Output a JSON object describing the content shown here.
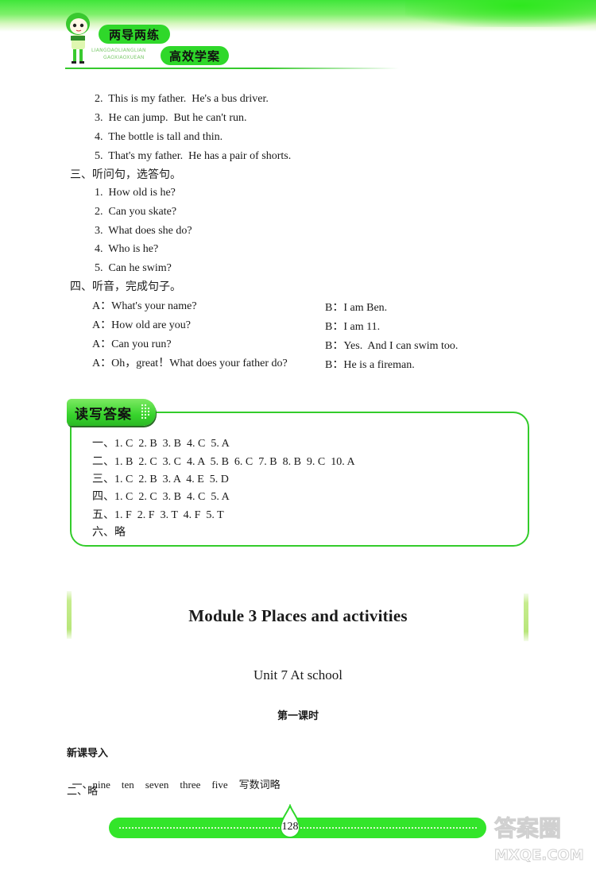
{
  "header": {
    "brand_line1": "两导两练",
    "brand_line2": "高效学案",
    "pinyin_line1": "LIANGDAOLIANGLIAN",
    "pinyin_line2": "GAOXIAOXUEAN",
    "accent_color": "#33d82a"
  },
  "listening_items_cont": [
    "2.  This is my father.  He's a bus driver.",
    "3.  He can jump.  But he can't run.",
    "4.  The bottle is tall and thin.",
    "5.  That's my father.  He has a pair of shorts."
  ],
  "section3": {
    "heading": "三、听问句，选答句。",
    "items": [
      "1.  How old is he?",
      "2.  Can you skate?",
      "3.  What does she do?",
      "4.  Who is he?",
      "5.  Can he swim?"
    ]
  },
  "section4": {
    "heading": "四、听音，完成句子。",
    "dialogue": [
      {
        "a": "A：What's your name?",
        "b": "B：I am Ben."
      },
      {
        "a": "A：How old are you?",
        "b": "B：I am 11."
      },
      {
        "a": "A：Can you run?",
        "b": "B：Yes.  And I can swim too."
      },
      {
        "a": "A：Oh，great！What does your father do?",
        "b": "B：He is a fireman."
      }
    ]
  },
  "answers": {
    "tab_label": "读写答案",
    "lines": [
      "一、1. C  2. B  3. B  4. C  5. A",
      "二、1. B  2. C  3. C  4. A  5. B  6. C  7. B  8. B  9. C  10. A",
      "三、1. C  2. B  3. A  4. E  5. D",
      "四、1. C  2. C  3. B  4. C  5. A",
      "五、1. F  2. F  3. T  4. F  5. T",
      "六、略"
    ]
  },
  "module": {
    "title": "Module 3 Places and activities",
    "unit": "Unit 7 At school",
    "lesson": "第一课时",
    "intro_heading": "新课导入",
    "intro_line1_prefix": "一、",
    "intro_line1_words": [
      "nine",
      "ten",
      "seven",
      "three",
      "five"
    ],
    "intro_line1_suffix": "写数词略",
    "intro_line2": "二、略"
  },
  "footer": {
    "page_number": "128",
    "watermark_cn": "答案圈",
    "watermark_en": "MXQE.COM"
  }
}
